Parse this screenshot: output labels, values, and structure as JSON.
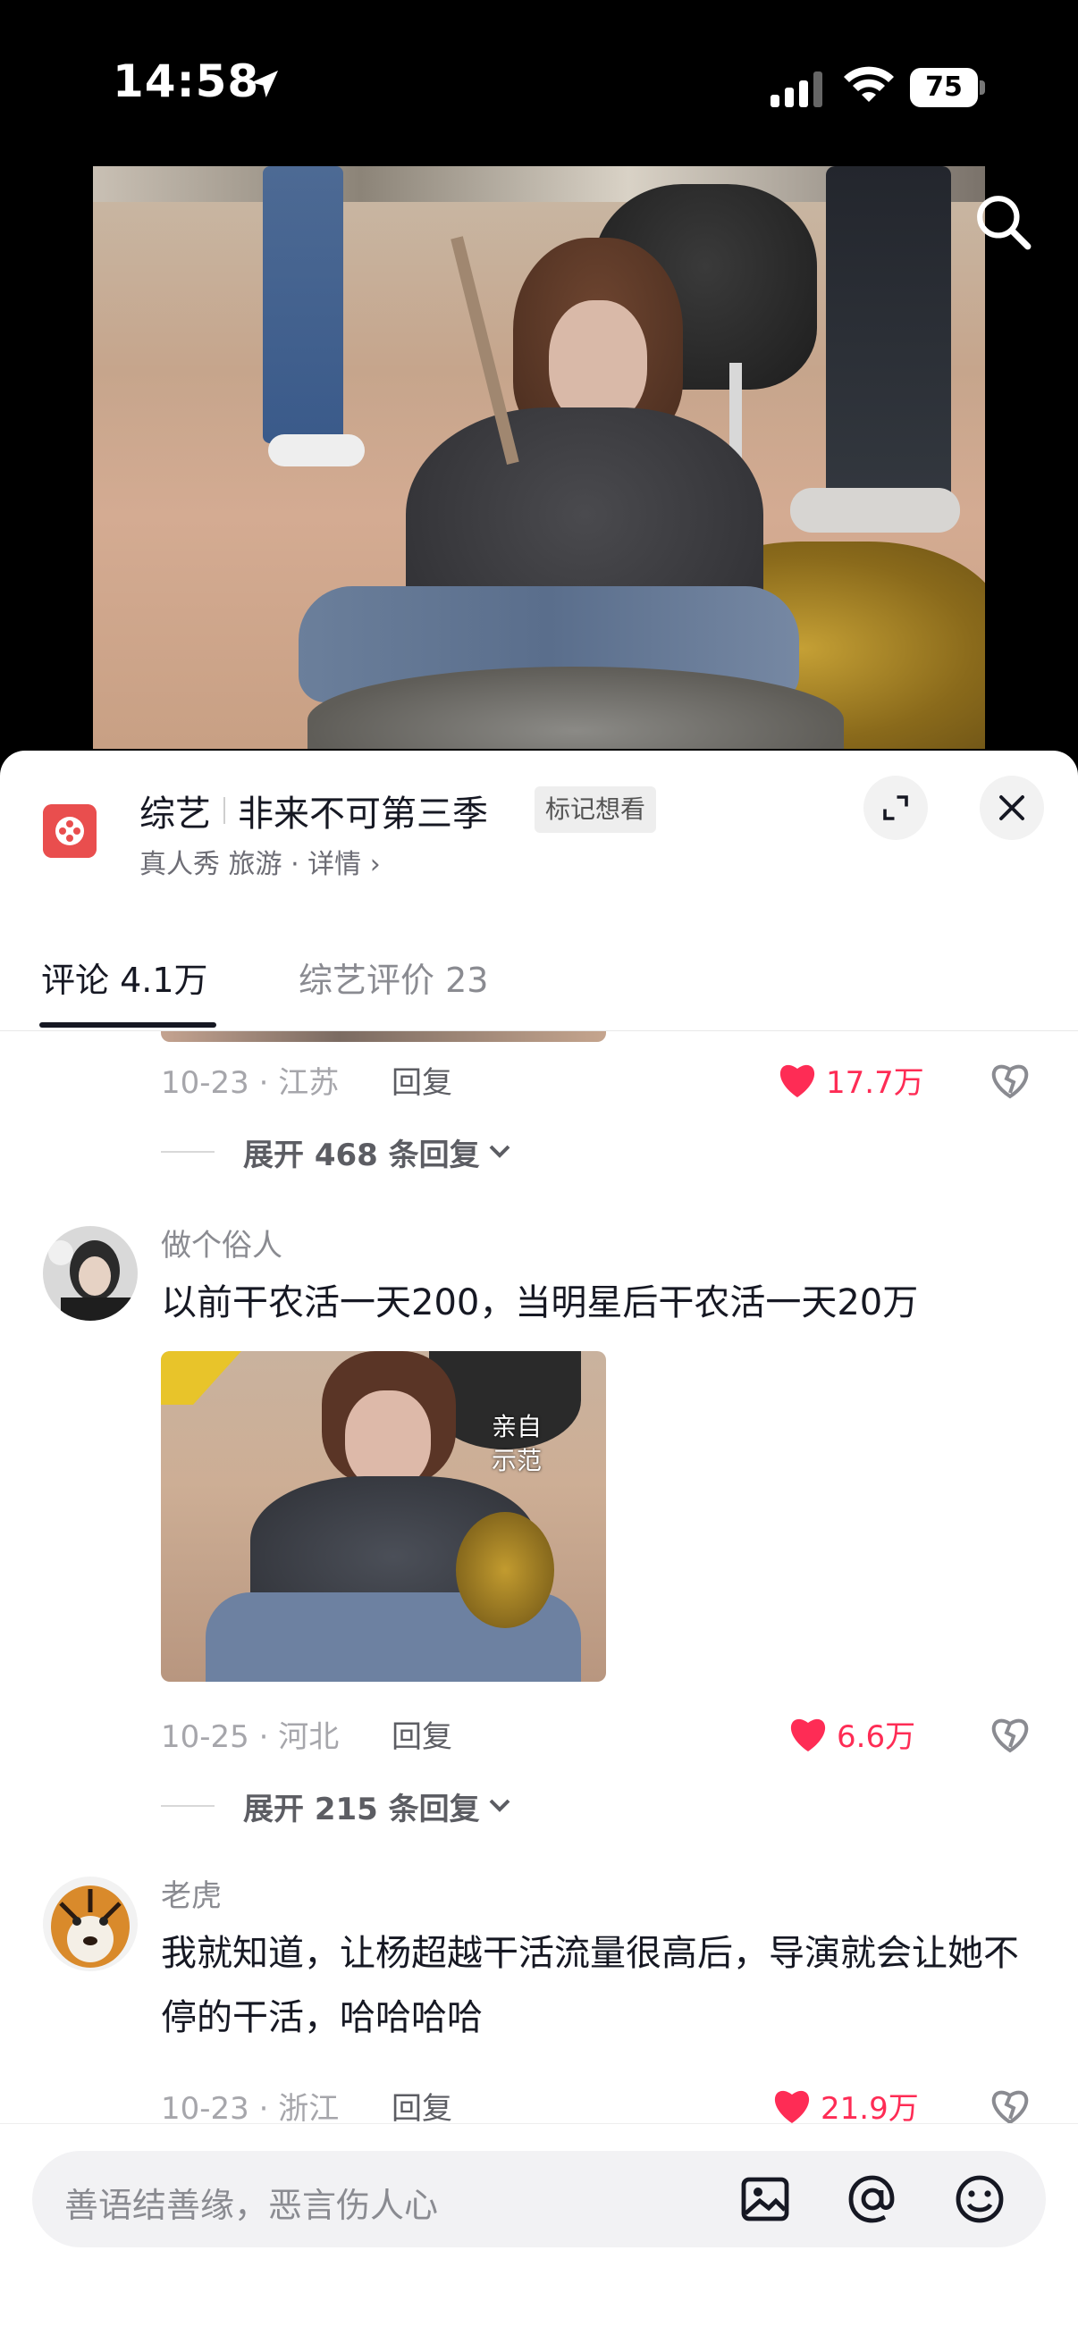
{
  "status_bar": {
    "time": "14:58",
    "battery": "75",
    "icons": [
      "location-arrow-icon",
      "cellular-signal-icon",
      "wifi-icon",
      "battery-icon"
    ]
  },
  "video": {
    "search_icon": "search-icon"
  },
  "show": {
    "category": "综艺",
    "title": "非来不可第三季",
    "mark_label": "标记想看",
    "meta": "真人秀 旅游 · 详情",
    "meta_chevron": "›"
  },
  "tabs": [
    {
      "label": "评论 4.1万",
      "active": true
    },
    {
      "label": "综艺评价 23",
      "active": false
    }
  ],
  "comments": [
    {
      "date_location": "10-23 · 江苏",
      "reply_label": "回复",
      "likes": "17.7万",
      "expand_label": "展开 468 条回复"
    },
    {
      "username": "做个俗人",
      "text": "以前干农活一天200，当明星后干农活一天20万",
      "image_caption_1": "亲自",
      "image_caption_2": "示范",
      "date_location": "10-25 · 河北",
      "reply_label": "回复",
      "likes": "6.6万",
      "expand_label": "展开 215 条回复"
    },
    {
      "username": "老虎",
      "text": "我就知道，让杨超越干活流量很高后，导演就会让她不停的干活，哈哈哈哈",
      "date_location": "10-23 · 浙江",
      "reply_label": "回复",
      "likes": "21.9万"
    }
  ],
  "input": {
    "placeholder": "善语结善缘，恶言伤人心"
  },
  "colors": {
    "accent": "#fe2c55",
    "text_primary": "#161823",
    "text_secondary": "#8a8b91"
  }
}
